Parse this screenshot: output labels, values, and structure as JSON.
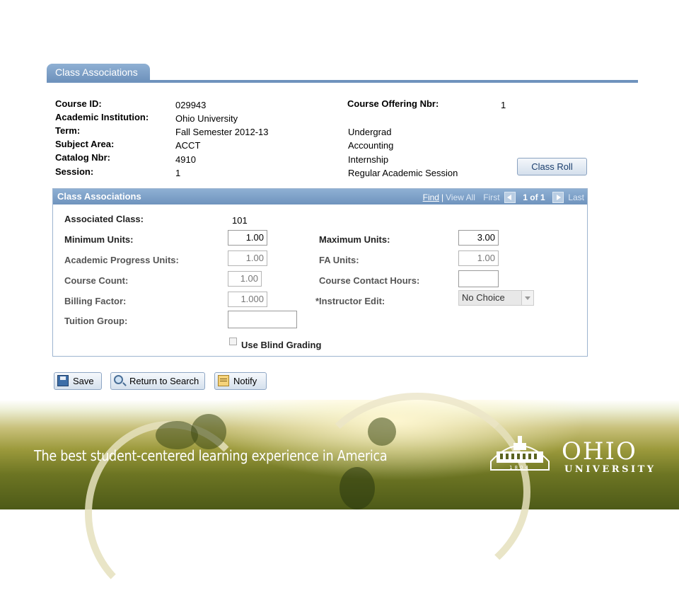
{
  "tab": {
    "label": "Class Associations"
  },
  "course_info": {
    "course_id_label": "Course ID:",
    "course_id": "029943",
    "institution_label": "Academic Institution:",
    "institution": "Ohio University",
    "term_label": "Term:",
    "term": "Fall Semester 2012-13",
    "subject_label": "Subject Area:",
    "subject": "ACCT",
    "catalog_label": "Catalog Nbr:",
    "catalog": "4910",
    "session_label": "Session:",
    "session": "1",
    "offering_label": "Course Offering Nbr:",
    "offering": "1",
    "career": "Undergrad",
    "subject_desc": "Accounting",
    "catalog_desc": "Internship",
    "session_desc": "Regular Academic Session",
    "class_roll_button": "Class Roll"
  },
  "panel": {
    "title": "Class Associations",
    "nav": {
      "find": "Find",
      "separator": "|",
      "view_all": "View All",
      "first": "First",
      "count": "1 of 1",
      "last": "Last"
    },
    "fields": {
      "associated_class_label": "Associated Class:",
      "associated_class": "101",
      "min_units_label": "Minimum Units:",
      "min_units": "1.00",
      "max_units_label": "Maximum Units:",
      "max_units": "3.00",
      "progress_units_label": "Academic Progress Units:",
      "progress_units": "1.00",
      "fa_units_label": "FA Units:",
      "fa_units": "1.00",
      "course_count_label": "Course Count:",
      "course_count": "1.00",
      "contact_hours_label": "Course Contact Hours:",
      "contact_hours": "",
      "billing_factor_label": "Billing Factor:",
      "billing_factor": "1.000",
      "instructor_edit_label": "*Instructor Edit:",
      "instructor_edit": "No Choice",
      "tuition_group_label": "Tuition Group:",
      "tuition_group": "",
      "blind_grading_label": "Use Blind Grading"
    }
  },
  "footer": {
    "save": "Save",
    "return_to_search": "Return to Search",
    "notify": "Notify"
  },
  "banner": {
    "tagline": "The best student-centered learning experience in America",
    "logo_word": "OHIO",
    "logo_sub": "UNIVERSITY",
    "seal_year": "1804"
  }
}
